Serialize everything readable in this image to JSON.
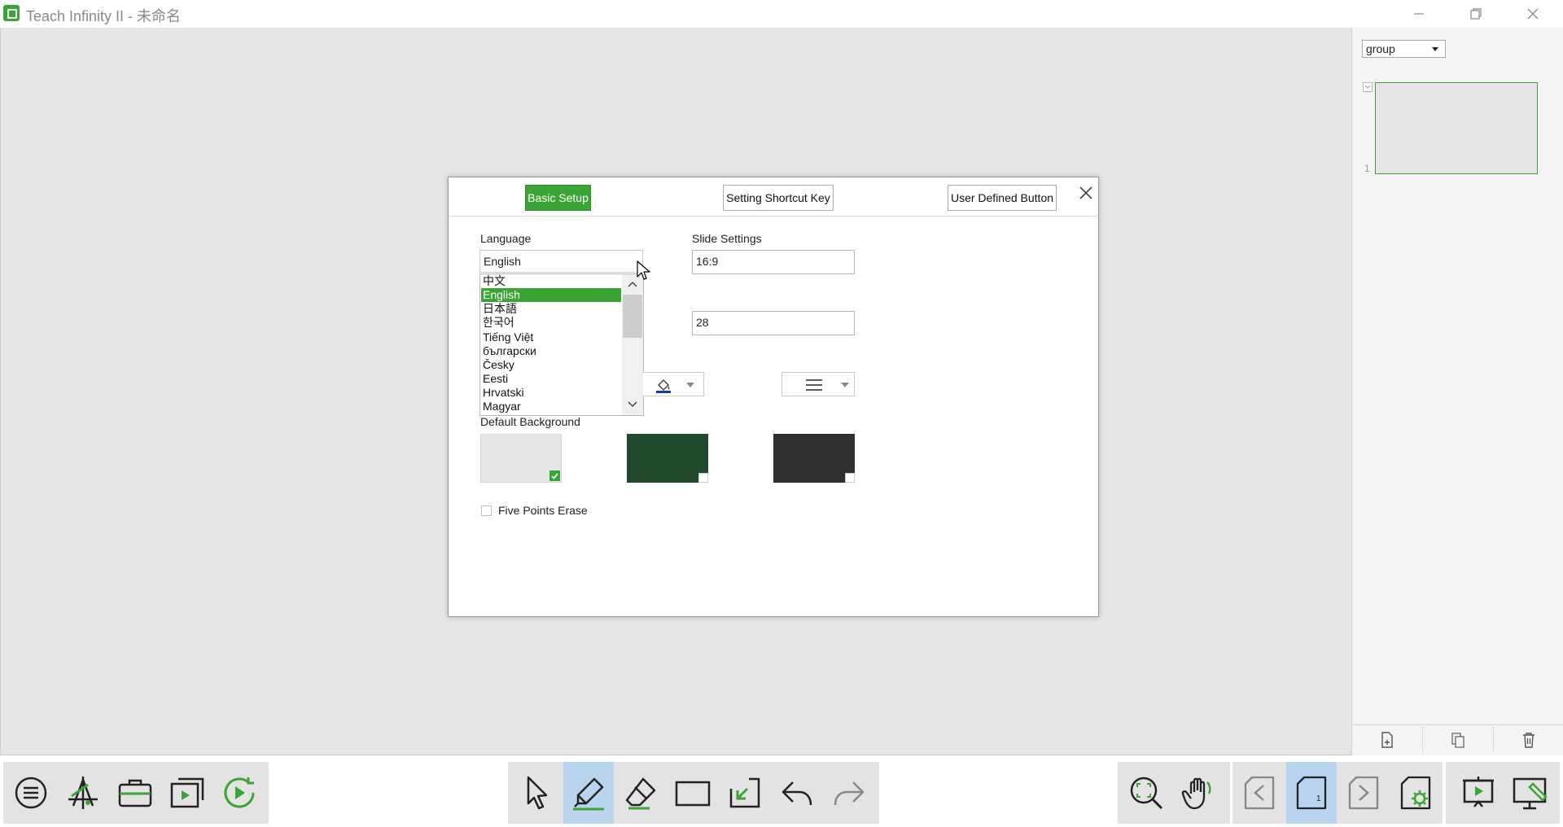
{
  "window": {
    "title": "Teach Infinity II - 未命名",
    "minimize_icon": "minimize-icon",
    "restore_icon": "restore-icon",
    "close_icon": "close-icon"
  },
  "right_panel": {
    "group_select_value": "group",
    "slide_number": "1",
    "footer_icons": [
      "add-page-icon",
      "copy-page-icon",
      "delete-page-icon"
    ]
  },
  "dialog": {
    "tabs": {
      "basic_setup": "Basic Setup",
      "shortcut_key": "Setting Shortcut Key",
      "user_defined": "User Defined Button"
    },
    "language_label": "Language",
    "language_selected": "English",
    "language_options": [
      "中文",
      "English",
      "日本語",
      "한국어",
      "Tiếng Việt",
      "български",
      "Česky",
      "Eesti",
      "Hrvatski",
      "Magyar"
    ],
    "slide_settings_label": "Slide Settings",
    "slide_ratio": "16:9",
    "size_value": "28",
    "default_background_label": "Default Background",
    "backgrounds": [
      {
        "name": "light-gray",
        "color": "#e6e6e6",
        "selected": true
      },
      {
        "name": "dark-green",
        "color": "#1f4a2c",
        "selected": false
      },
      {
        "name": "dark-gray",
        "color": "#2f2f2f",
        "selected": false
      }
    ],
    "five_points_erase_label": "Five Points Erase"
  },
  "colors": {
    "accent": "#3aa535",
    "canvas": "#e6e6e6",
    "toolbar_group": "#e3e3e3",
    "active_tool": "#b8d4ee"
  },
  "toolbar": {
    "left": [
      "menu-icon",
      "geometry-tools-icon",
      "toolbox-icon",
      "media-icon",
      "playback-icon"
    ],
    "center": [
      "select-arrow-icon",
      "pen-icon",
      "eraser-icon",
      "rectangle-icon",
      "insert-icon",
      "undo-icon",
      "redo-icon"
    ],
    "right_zoom": [
      "zoom-icon",
      "hand-pan-icon"
    ],
    "right_pages": [
      "previous-page-icon",
      "current-page-icon",
      "next-page-icon",
      "page-settings-icon"
    ],
    "right_display": [
      "presentation-icon",
      "desktop-annotate-icon"
    ],
    "current_page": "1"
  }
}
